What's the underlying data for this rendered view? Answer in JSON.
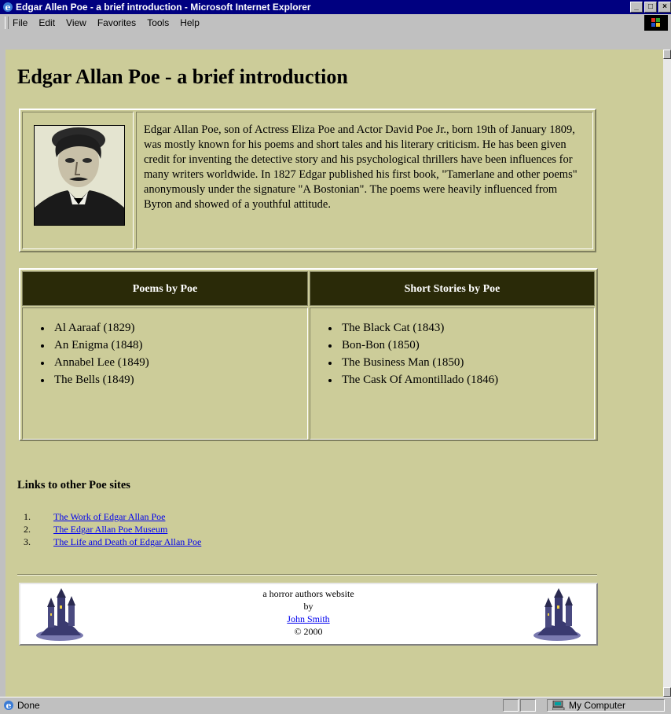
{
  "window": {
    "title": "Edgar Allen Poe - a brief introduction - Microsoft Internet Explorer",
    "buttons": [
      "_",
      "□",
      "×"
    ]
  },
  "menubar": {
    "items": [
      "File",
      "Edit",
      "View",
      "Favorites",
      "Tools",
      "Help"
    ]
  },
  "page": {
    "heading": "Edgar Allan Poe - a brief introduction",
    "bio": "Edgar Allan Poe, son of Actress Eliza Poe and Actor David Poe Jr., born 19th of January 1809, was mostly known for his poems and short tales and his literary criticism. He has been given credit for inventing the detective story and his psychological thrillers have been influences for many writers worldwide. In 1827 Edgar published his first book, \"Tamerlane and other poems\" anonymously under the signature \"A Bostonian\". The poems were heavily influenced from Byron and showed of a youthful attitude.",
    "poems": {
      "heading": "Poems by Poe",
      "items": [
        "Al Aaraaf (1829)",
        "An Enigma (1848)",
        "Annabel Lee (1849)",
        "The Bells (1849)"
      ]
    },
    "stories": {
      "heading": "Short Stories by Poe",
      "items": [
        "The Black Cat (1843)",
        "Bon-Bon (1850)",
        "The Business Man (1850)",
        "The Cask Of Amontillado (1846)"
      ]
    },
    "links_heading": "Links to other Poe sites",
    "links": [
      {
        "num": "1.",
        "label": "The Work of Edgar Allan Poe"
      },
      {
        "num": "2.",
        "label": "The Edgar Allan Poe Museum"
      },
      {
        "num": "3.",
        "label": "The Life and Death of Edgar Allan Poe"
      }
    ],
    "footer": {
      "line1": "a horror authors website",
      "line2": "by",
      "author_link": "John Smith",
      "copyright": "© 2000"
    }
  },
  "statusbar": {
    "status": "Done",
    "zone": "My Computer"
  },
  "colors": {
    "page_background": "#cccc99",
    "table_header": "#2a2a08",
    "link": "#0000ee"
  }
}
